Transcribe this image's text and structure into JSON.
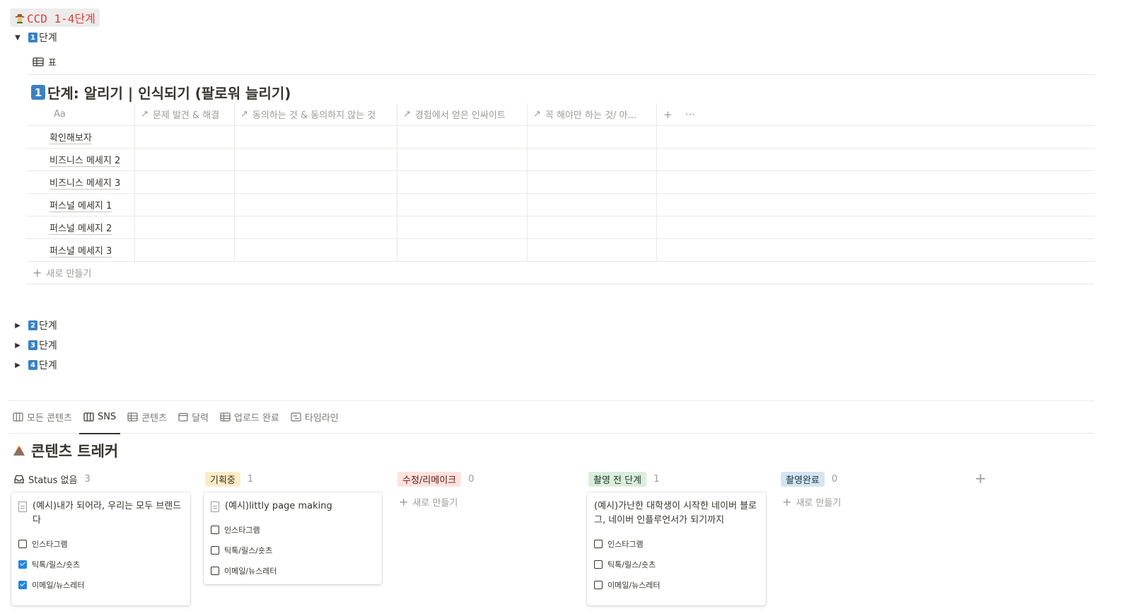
{
  "page": {
    "title": "CCD 1-4단계",
    "title_icon": "cowboy-emoji-icon"
  },
  "stages": [
    {
      "num": "1",
      "label": "단계",
      "expanded": true
    },
    {
      "num": "2",
      "label": "단계",
      "expanded": false
    },
    {
      "num": "3",
      "label": "단계",
      "expanded": false
    },
    {
      "num": "4",
      "label": "단계",
      "expanded": false
    }
  ],
  "stage1": {
    "view_label": "표",
    "db_title_num": "1",
    "db_title": "단계: 알리기 | 인식되기 (팔로워 늘리기)",
    "columns": [
      "Aa",
      "문제 발견 & 해결",
      "동의하는 것 & 동의하지 않는 것",
      "경험에서 얻은 인싸이트",
      "꼭 해야만 하는 것/ 아..."
    ],
    "rows": [
      "확인해보자",
      "비즈니스 메세지 2",
      "비즈니스 메세지 3",
      "퍼스널 메세지 1",
      "퍼스널 메세지 2",
      "퍼스널 메세지 3"
    ],
    "new_label": "새로 만들기",
    "add_col": "+",
    "more": "···"
  },
  "tabs": [
    {
      "label": "모든 콘텐츠",
      "icon": "board-icon",
      "active": false
    },
    {
      "label": "SNS",
      "icon": "board-icon",
      "active": true
    },
    {
      "label": "콘텐츠",
      "icon": "table-icon",
      "active": false
    },
    {
      "label": "달력",
      "icon": "calendar-icon",
      "active": false
    },
    {
      "label": "업로드 완료",
      "icon": "table-icon",
      "active": false
    },
    {
      "label": "타임라인",
      "icon": "timeline-icon",
      "active": false
    }
  ],
  "tracker": {
    "title": "콘텐츠 트레커",
    "icon": "volcano-icon"
  },
  "board": {
    "columns": [
      {
        "label": "Status 없음",
        "count": "3",
        "bg": "",
        "color": "#37352f"
      },
      {
        "label": "기획중",
        "count": "1",
        "bg": "#fdecc8",
        "color": "#402c1b"
      },
      {
        "label": "수정/리메이크",
        "count": "0",
        "bg": "#ffe2dd",
        "color": "#5d1715"
      },
      {
        "label": "촬영 전 단계",
        "count": "1",
        "bg": "#dbeddb",
        "color": "#1c3829"
      },
      {
        "label": "촬영완료",
        "count": "0",
        "bg": "#d3e5ef",
        "color": "#183347"
      }
    ],
    "new_label": "새로 만들기",
    "add_group": "+",
    "cards": [
      {
        "title": "(예시)내가 되어라, 우리는 모두 브랜드다",
        "checks": [
          {
            "label": "인스타그램",
            "checked": false
          },
          {
            "label": "틱톡/릴스/숏츠",
            "checked": true
          },
          {
            "label": "이메일/뉴스레터",
            "checked": true
          }
        ]
      },
      {
        "title": "(예시)littly page making",
        "checks": [
          {
            "label": "인스타그램",
            "checked": false
          },
          {
            "label": "틱톡/릴스/숏츠",
            "checked": false
          },
          {
            "label": "이메일/뉴스레터",
            "checked": false
          }
        ]
      },
      {
        "title": "(예시)가난한 대학생이 시작한 네이버 블로그, 네이버 인플루언서가 되기까지",
        "checks": [
          {
            "label": "인스타그램",
            "checked": false
          },
          {
            "label": "틱톡/릴스/숏츠",
            "checked": false
          },
          {
            "label": "이메일/뉴스레터",
            "checked": false
          }
        ]
      }
    ]
  }
}
